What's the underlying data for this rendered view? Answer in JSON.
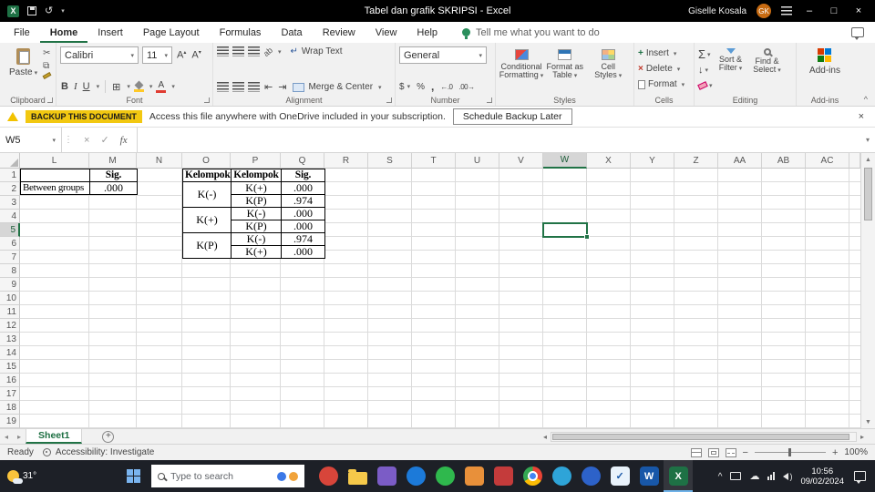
{
  "title_bar": {
    "title": "Tabel dan grafik SKRIPSI  -  Excel",
    "user_name": "Giselle Kosala",
    "user_initials": "GK"
  },
  "ribbon_tabs": {
    "items": [
      "File",
      "Home",
      "Insert",
      "Page Layout",
      "Formulas",
      "Data",
      "Review",
      "View",
      "Help"
    ],
    "active": "Home",
    "tell_me": "Tell me what you want to do"
  },
  "ribbon": {
    "clipboard": {
      "paste": "Paste",
      "label": "Clipboard"
    },
    "font": {
      "name": "Calibri",
      "size": "11",
      "label": "Font"
    },
    "alignment": {
      "wrap_text": "Wrap Text",
      "merge_center": "Merge & Center",
      "label": "Alignment"
    },
    "number": {
      "format": "General",
      "label": "Number"
    },
    "styles": {
      "conditional": "Conditional Formatting",
      "format_table": "Format as Table",
      "cell_styles": "Cell Styles",
      "label": "Styles"
    },
    "cells": {
      "insert": "Insert",
      "delete": "Delete",
      "format": "Format",
      "label": "Cells"
    },
    "editing": {
      "sort_filter": "Sort & Filter",
      "find_select": "Find & Select",
      "label": "Editing"
    },
    "addins": {
      "button": "Add-ins",
      "label": "Add-ins"
    }
  },
  "notification": {
    "badge": "BACKUP THIS DOCUMENT",
    "message": "Access this file anywhere with OneDrive included in your subscription.",
    "action": "Schedule Backup Later"
  },
  "formula_bar": {
    "name_box": "W5",
    "fx": "fx",
    "value": ""
  },
  "sheet": {
    "columns": [
      "L",
      "M",
      "N",
      "O",
      "P",
      "Q",
      "R",
      "S",
      "T",
      "U",
      "V",
      "W",
      "X",
      "Y",
      "Z",
      "AA",
      "AB",
      "AC"
    ],
    "row_count": 19,
    "selected_cell": "W5",
    "selected_column": "W",
    "selected_row": 5,
    "sig_table": {
      "cells": [
        [
          "",
          "Sig."
        ],
        [
          "Between groups",
          ".000"
        ]
      ]
    },
    "groups_table": {
      "col_headers": [
        "Kelompok",
        "Kelompok",
        "Sig."
      ],
      "groups": [
        {
          "name": "K(-)",
          "rows": [
            [
              "K(+)",
              ".000"
            ],
            [
              "K(P)",
              ".974"
            ]
          ]
        },
        {
          "name": "K(+)",
          "rows": [
            [
              "K(-)",
              ".000"
            ],
            [
              "K(P)",
              ".000"
            ]
          ]
        },
        {
          "name": "K(P)",
          "rows": [
            [
              "K(-)",
              ".974"
            ],
            [
              "K(+)",
              ".000"
            ]
          ]
        }
      ]
    }
  },
  "sheet_tabs": {
    "active": "Sheet1"
  },
  "status_bar": {
    "mode": "Ready",
    "accessibility": "Accessibility: Investigate",
    "zoom": "100%"
  },
  "taskbar": {
    "temperature": "31°",
    "search_placeholder": "Type to search",
    "time": "10:56",
    "date": "09/02/2024",
    "apps": [
      {
        "name": "app-red",
        "color": "#d8453a",
        "glyph": "",
        "shape": "round"
      },
      {
        "name": "file-explorer",
        "color": "#f6c94a",
        "glyph": "",
        "shape": "folder"
      },
      {
        "name": "app-purple",
        "color": "#7b5cc6",
        "glyph": "",
        "shape": "square"
      },
      {
        "name": "edge-browser",
        "color": "#1c7ad9",
        "glyph": "",
        "shape": "round"
      },
      {
        "name": "whatsapp",
        "color": "#2fb84d",
        "glyph": "",
        "shape": "round"
      },
      {
        "name": "app-orange",
        "color": "#e8903a",
        "glyph": "",
        "shape": "square"
      },
      {
        "name": "app-crimson",
        "color": "#c43b3b",
        "glyph": "",
        "shape": "square"
      },
      {
        "name": "chrome",
        "color": "",
        "glyph": "",
        "shape": "chrome"
      },
      {
        "name": "telegram",
        "color": "#2ea4d8",
        "glyph": "",
        "shape": "round"
      },
      {
        "name": "app-blue",
        "color": "#2d62c9",
        "glyph": "",
        "shape": "round"
      },
      {
        "name": "app-check",
        "color": "#e9f2fb",
        "glyph": "✓",
        "text": "#1857a8",
        "shape": "square"
      },
      {
        "name": "word",
        "color": "#1857a8",
        "glyph": "W",
        "shape": "square"
      },
      {
        "name": "excel",
        "color": "#1e7145",
        "glyph": "X",
        "shape": "square",
        "active": true
      }
    ]
  }
}
